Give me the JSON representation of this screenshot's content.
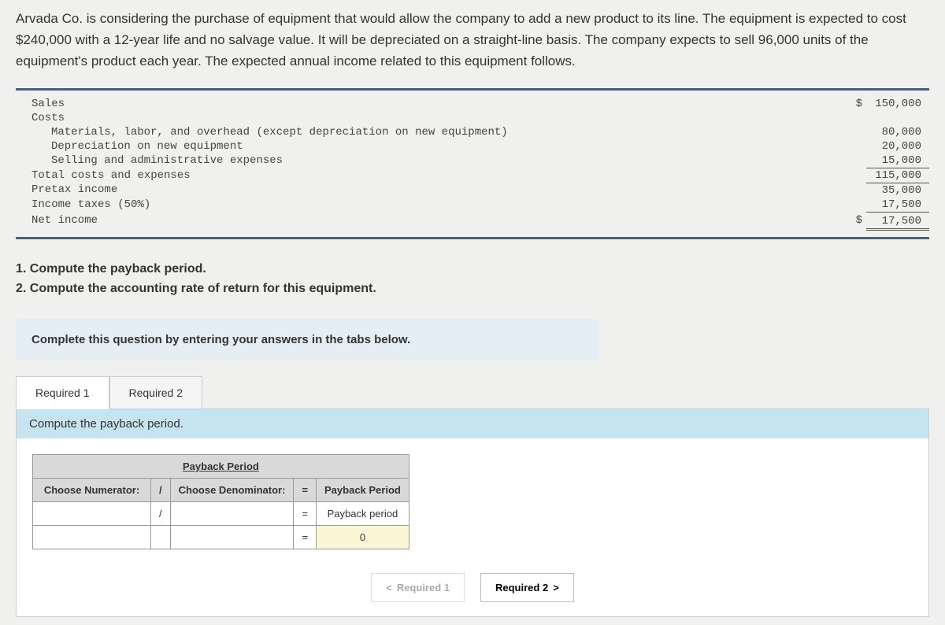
{
  "problem": "Arvada Co. is considering the purchase of equipment that would allow the company to add a new product to its line. The equipment is expected to cost $240,000 with a 12-year life and no salvage value. It will be depreciated on a straight-line basis. The company expects to sell 96,000 units of the equipment's product each year. The expected annual income related to this equipment follows.",
  "income": {
    "rows": [
      {
        "label": "Sales",
        "indent": false,
        "cur": "$",
        "value": "150,000",
        "line": ""
      },
      {
        "label": "Costs",
        "indent": false,
        "cur": "",
        "value": "",
        "line": ""
      },
      {
        "label": "Materials, labor, and overhead (except depreciation on new equipment)",
        "indent": true,
        "cur": "",
        "value": "80,000",
        "line": ""
      },
      {
        "label": "Depreciation on new equipment",
        "indent": true,
        "cur": "",
        "value": "20,000",
        "line": ""
      },
      {
        "label": "Selling and administrative expenses",
        "indent": true,
        "cur": "",
        "value": "15,000",
        "line": "underline"
      },
      {
        "label": "Total costs and expenses",
        "indent": false,
        "cur": "",
        "value": "115,000",
        "line": "underline"
      },
      {
        "label": "Pretax income",
        "indent": false,
        "cur": "",
        "value": "35,000",
        "line": ""
      },
      {
        "label": "Income taxes (50%)",
        "indent": false,
        "cur": "",
        "value": "17,500",
        "line": "underline"
      },
      {
        "label": "Net income",
        "indent": false,
        "cur": "$",
        "value": "17,500",
        "line": "dbl-underline"
      }
    ]
  },
  "questions": {
    "q1": "1. Compute the payback period.",
    "q2": "2. Compute the accounting rate of return for this equipment."
  },
  "instruction": "Complete this question by entering your answers in the tabs below.",
  "tabs": {
    "t1": "Required 1",
    "t2": "Required 2"
  },
  "tab_prompt": "Compute the payback period.",
  "payback": {
    "title": "Payback Period",
    "h_num": "Choose Numerator:",
    "slash1": "/",
    "h_den": "Choose Denominator:",
    "eq1": "=",
    "h_res": "Payback Period",
    "slash2": "/",
    "eq2": "=",
    "label_row": "Payback period",
    "eq3": "=",
    "result": "0"
  },
  "nav": {
    "prev_icon": "<",
    "prev": "Required 1",
    "next": "Required 2",
    "next_icon": ">"
  }
}
